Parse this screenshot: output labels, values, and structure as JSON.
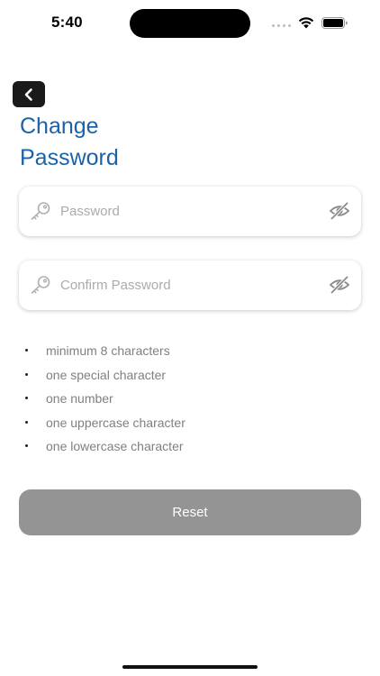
{
  "status_bar": {
    "time": "5:40"
  },
  "header": {
    "back_icon": "chevron-left-icon",
    "title_line1": "Change",
    "title_line2": "Password"
  },
  "form": {
    "password": {
      "placeholder": "Password",
      "value": "",
      "leading_icon": "key-icon",
      "trailing_icon": "eye-off-icon"
    },
    "confirm_password": {
      "placeholder": "Confirm Password",
      "value": "",
      "leading_icon": "key-icon",
      "trailing_icon": "eye-off-icon"
    }
  },
  "requirements": [
    "minimum 8 characters",
    "one special character",
    "one number",
    "one uppercase character",
    "one lowercase character"
  ],
  "reset_button": {
    "label": "Reset"
  },
  "colors": {
    "title": "#1b63a8",
    "button_disabled": "#949494",
    "placeholder": "#ababab",
    "requirement_text": "#808080",
    "back_button_bg": "#1a1a1a"
  }
}
